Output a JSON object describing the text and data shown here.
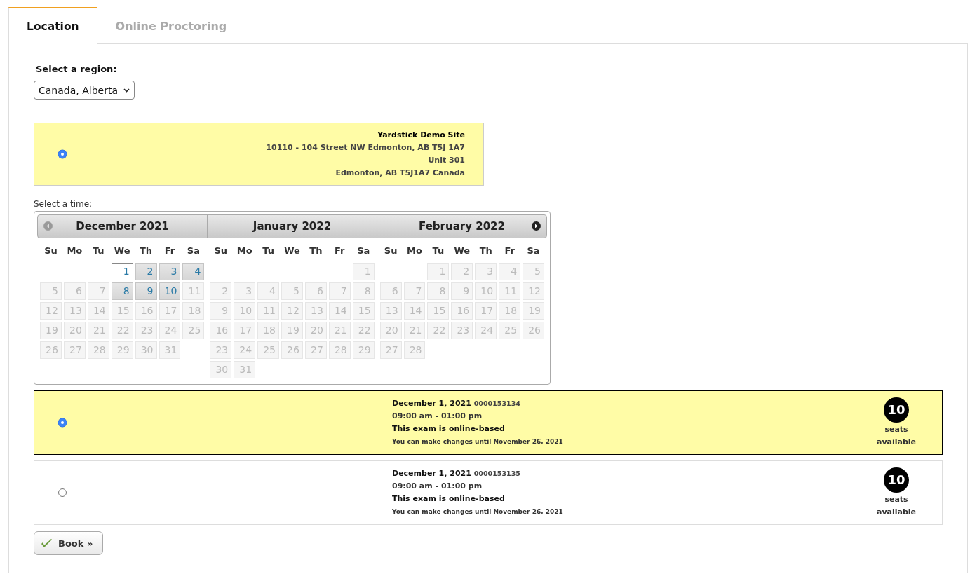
{
  "tabs": [
    {
      "label": "Location",
      "selected": true
    },
    {
      "label": "Online Proctoring",
      "selected": false
    }
  ],
  "region": {
    "label": "Select a region:",
    "value": "Canada, Alberta"
  },
  "sites": [
    {
      "selected": true,
      "name": "Yardstick Demo Site",
      "lines": [
        "10110 - 104 Street NW Edmonton, AB T5J 1A7",
        "Unit 301",
        "Edmonton, AB T5J1A7 Canada"
      ]
    }
  ],
  "time_label": "Select a time:",
  "calendar": {
    "prev_enabled": false,
    "next_enabled": true,
    "months": [
      {
        "title": "December 2021",
        "weekdays": [
          "Su",
          "Mo",
          "Tu",
          "We",
          "Th",
          "Fr",
          "Sa"
        ],
        "weeks": [
          [
            {
              "day": "1",
              "available": true,
              "selected": true
            },
            {
              "day": "2",
              "available": true,
              "selected": false
            },
            {
              "day": "3",
              "available": true,
              "selected": false
            },
            {
              "day": "4",
              "available": true,
              "selected": false
            }
          ],
          [
            {
              "day": "5",
              "available": false,
              "selected": false
            },
            {
              "day": "6",
              "available": false,
              "selected": false
            },
            {
              "day": "7",
              "available": false,
              "selected": false
            },
            {
              "day": "8",
              "available": true,
              "selected": false
            },
            {
              "day": "9",
              "available": true,
              "selected": false
            },
            {
              "day": "10",
              "available": true,
              "selected": false
            },
            {
              "day": "11",
              "available": false,
              "selected": false
            }
          ],
          [
            {
              "day": "12",
              "available": false,
              "selected": false
            },
            {
              "day": "13",
              "available": false,
              "selected": false
            },
            {
              "day": "14",
              "available": false,
              "selected": false
            },
            {
              "day": "15",
              "available": false,
              "selected": false
            },
            {
              "day": "16",
              "available": false,
              "selected": false
            },
            {
              "day": "17",
              "available": false,
              "selected": false
            },
            {
              "day": "18",
              "available": false,
              "selected": false
            }
          ],
          [
            {
              "day": "19",
              "available": false,
              "selected": false
            },
            {
              "day": "20",
              "available": false,
              "selected": false
            },
            {
              "day": "21",
              "available": false,
              "selected": false
            },
            {
              "day": "22",
              "available": false,
              "selected": false
            },
            {
              "day": "23",
              "available": false,
              "selected": false
            },
            {
              "day": "24",
              "available": false,
              "selected": false
            },
            {
              "day": "25",
              "available": false,
              "selected": false
            }
          ],
          [
            {
              "day": "26",
              "available": false,
              "selected": false
            },
            {
              "day": "27",
              "available": false,
              "selected": false
            },
            {
              "day": "28",
              "available": false,
              "selected": false
            },
            {
              "day": "29",
              "available": false,
              "selected": false
            },
            {
              "day": "30",
              "available": false,
              "selected": false
            },
            {
              "day": "31",
              "available": false,
              "selected": false
            }
          ]
        ]
      },
      {
        "title": "January 2022",
        "weekdays": [
          "Su",
          "Mo",
          "Tu",
          "We",
          "Th",
          "Fr",
          "Sa"
        ],
        "weeks": [
          [
            {
              "day": "1",
              "available": false,
              "selected": false
            }
          ],
          [
            {
              "day": "2",
              "available": false,
              "selected": false
            },
            {
              "day": "3",
              "available": false,
              "selected": false
            },
            {
              "day": "4",
              "available": false,
              "selected": false
            },
            {
              "day": "5",
              "available": false,
              "selected": false
            },
            {
              "day": "6",
              "available": false,
              "selected": false
            },
            {
              "day": "7",
              "available": false,
              "selected": false
            },
            {
              "day": "8",
              "available": false,
              "selected": false
            }
          ],
          [
            {
              "day": "9",
              "available": false,
              "selected": false
            },
            {
              "day": "10",
              "available": false,
              "selected": false
            },
            {
              "day": "11",
              "available": false,
              "selected": false
            },
            {
              "day": "12",
              "available": false,
              "selected": false
            },
            {
              "day": "13",
              "available": false,
              "selected": false
            },
            {
              "day": "14",
              "available": false,
              "selected": false
            },
            {
              "day": "15",
              "available": false,
              "selected": false
            }
          ],
          [
            {
              "day": "16",
              "available": false,
              "selected": false
            },
            {
              "day": "17",
              "available": false,
              "selected": false
            },
            {
              "day": "18",
              "available": false,
              "selected": false
            },
            {
              "day": "19",
              "available": false,
              "selected": false
            },
            {
              "day": "20",
              "available": false,
              "selected": false
            },
            {
              "day": "21",
              "available": false,
              "selected": false
            },
            {
              "day": "22",
              "available": false,
              "selected": false
            }
          ],
          [
            {
              "day": "23",
              "available": false,
              "selected": false
            },
            {
              "day": "24",
              "available": false,
              "selected": false
            },
            {
              "day": "25",
              "available": false,
              "selected": false
            },
            {
              "day": "26",
              "available": false,
              "selected": false
            },
            {
              "day": "27",
              "available": false,
              "selected": false
            },
            {
              "day": "28",
              "available": false,
              "selected": false
            },
            {
              "day": "29",
              "available": false,
              "selected": false
            }
          ],
          [
            {
              "day": "30",
              "available": false,
              "selected": false
            },
            {
              "day": "31",
              "available": false,
              "selected": false
            }
          ]
        ]
      },
      {
        "title": "February 2022",
        "weekdays": [
          "Su",
          "Mo",
          "Tu",
          "We",
          "Th",
          "Fr",
          "Sa"
        ],
        "weeks": [
          [
            {
              "day": "1",
              "available": false,
              "selected": false
            },
            {
              "day": "2",
              "available": false,
              "selected": false
            },
            {
              "day": "3",
              "available": false,
              "selected": false
            },
            {
              "day": "4",
              "available": false,
              "selected": false
            },
            {
              "day": "5",
              "available": false,
              "selected": false
            }
          ],
          [
            {
              "day": "6",
              "available": false,
              "selected": false
            },
            {
              "day": "7",
              "available": false,
              "selected": false
            },
            {
              "day": "8",
              "available": false,
              "selected": false
            },
            {
              "day": "9",
              "available": false,
              "selected": false
            },
            {
              "day": "10",
              "available": false,
              "selected": false
            },
            {
              "day": "11",
              "available": false,
              "selected": false
            },
            {
              "day": "12",
              "available": false,
              "selected": false
            }
          ],
          [
            {
              "day": "13",
              "available": false,
              "selected": false
            },
            {
              "day": "14",
              "available": false,
              "selected": false
            },
            {
              "day": "15",
              "available": false,
              "selected": false
            },
            {
              "day": "16",
              "available": false,
              "selected": false
            },
            {
              "day": "17",
              "available": false,
              "selected": false
            },
            {
              "day": "18",
              "available": false,
              "selected": false
            },
            {
              "day": "19",
              "available": false,
              "selected": false
            }
          ],
          [
            {
              "day": "20",
              "available": false,
              "selected": false
            },
            {
              "day": "21",
              "available": false,
              "selected": false
            },
            {
              "day": "22",
              "available": false,
              "selected": false
            },
            {
              "day": "23",
              "available": false,
              "selected": false
            },
            {
              "day": "24",
              "available": false,
              "selected": false
            },
            {
              "day": "25",
              "available": false,
              "selected": false
            },
            {
              "day": "26",
              "available": false,
              "selected": false
            }
          ],
          [
            {
              "day": "27",
              "available": false,
              "selected": false
            },
            {
              "day": "28",
              "available": false,
              "selected": false
            }
          ]
        ]
      }
    ]
  },
  "slots": [
    {
      "selected": true,
      "date": "December 1, 2021",
      "code": "0000153134",
      "time": "09:00 am - 01:00 pm",
      "note": "This exam is online-based",
      "deadline": "You can make changes until November 26, 2021",
      "seats": "10",
      "seats_label": "seats",
      "available_label": "available"
    },
    {
      "selected": false,
      "date": "December 1, 2021",
      "code": "0000153135",
      "time": "09:00 am - 01:00 pm",
      "note": "This exam is online-based",
      "deadline": "You can make changes until November 26, 2021",
      "seats": "10",
      "seats_label": "seats",
      "available_label": "available"
    }
  ],
  "book_button": "Book »"
}
